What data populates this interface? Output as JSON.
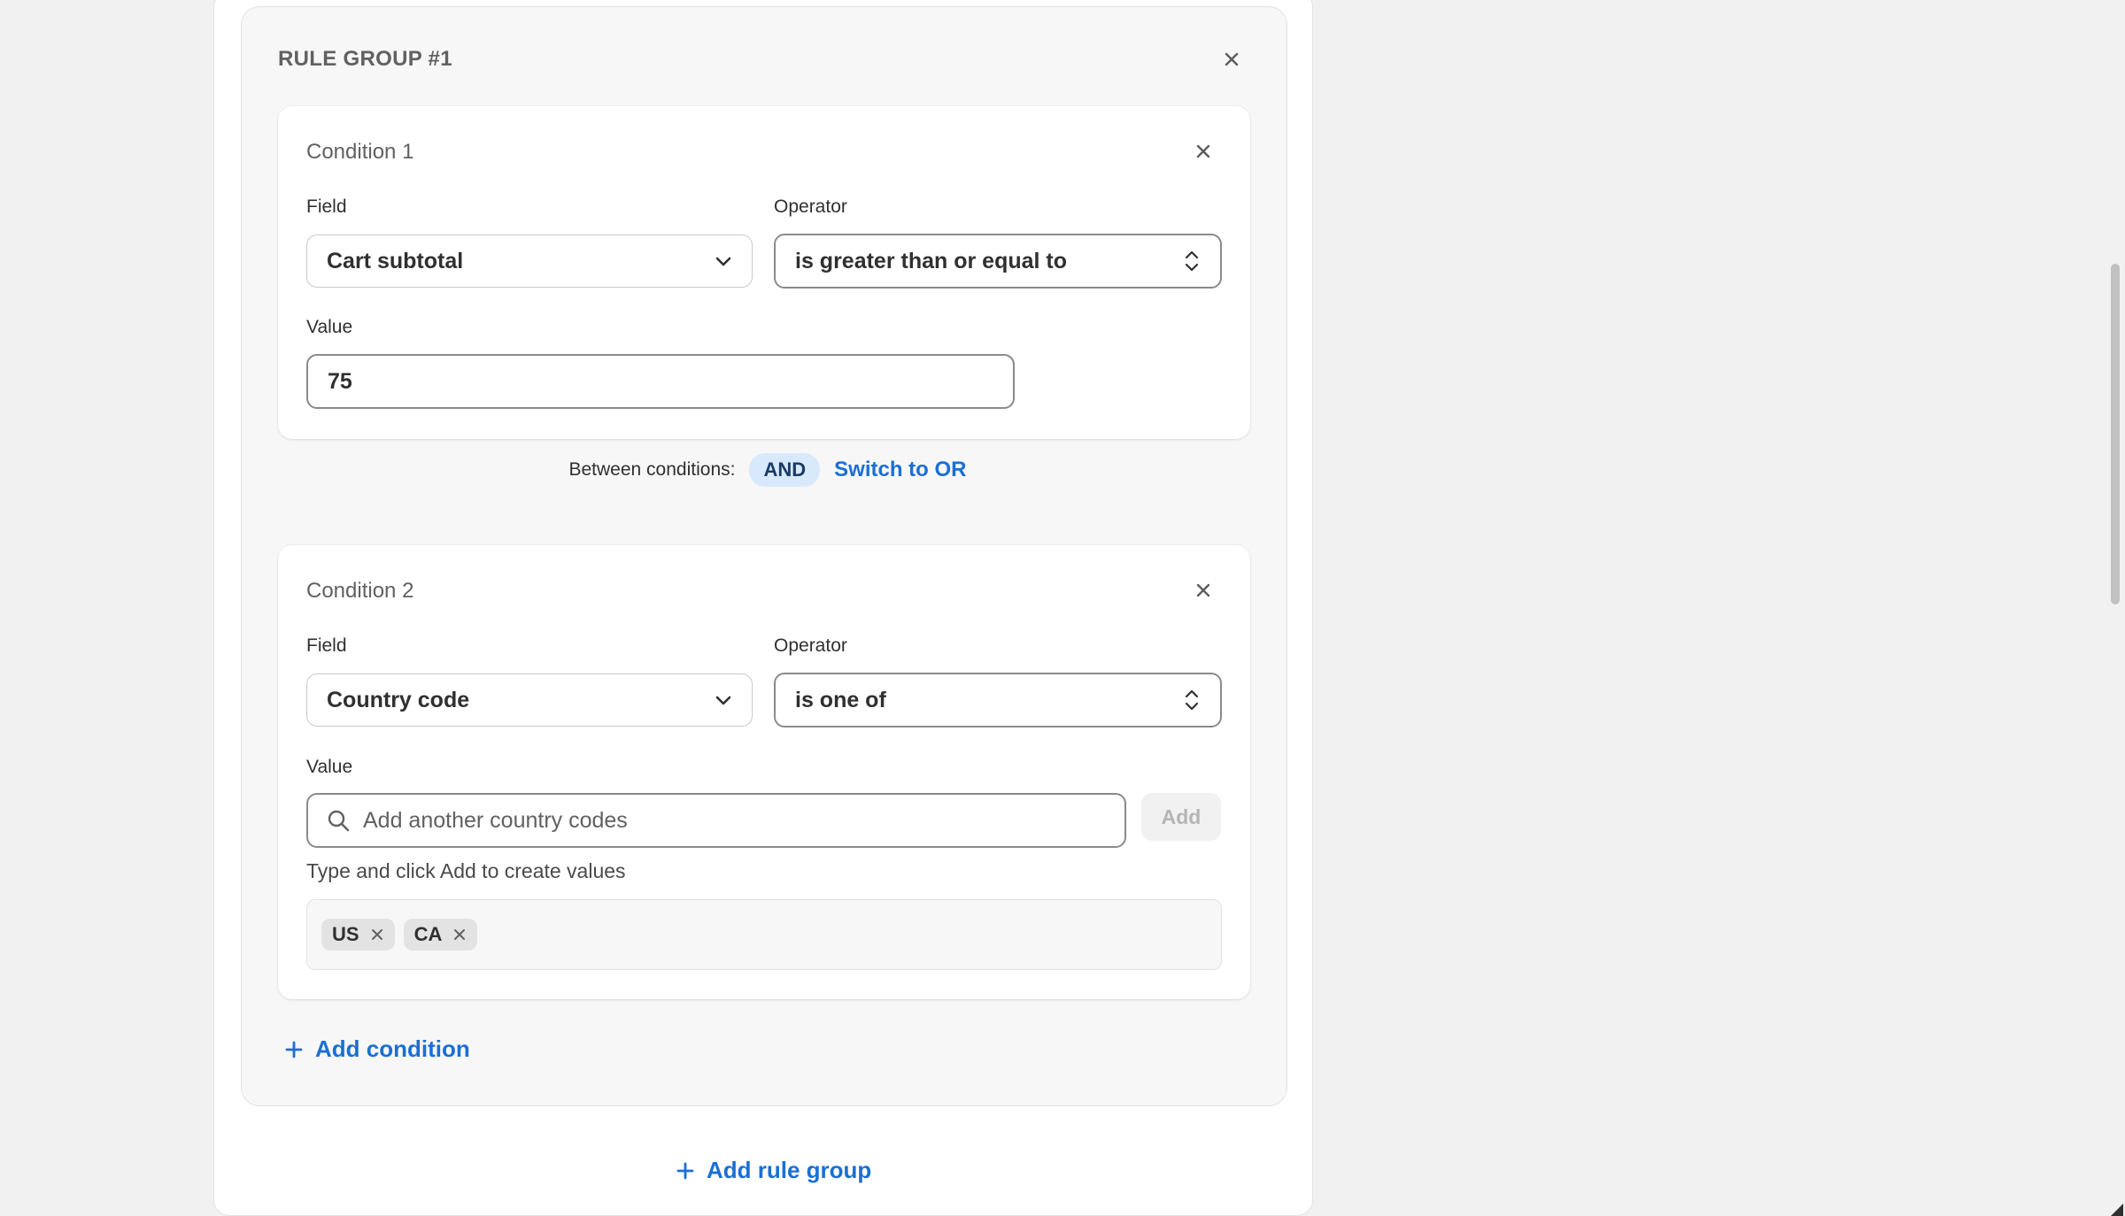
{
  "rule_group": {
    "title": "RULE GROUP #1",
    "close_icon": "close-icon"
  },
  "condition1": {
    "title": "Condition 1",
    "field_label": "Field",
    "field_value": "Cart subtotal",
    "operator_label": "Operator",
    "operator_value": "is greater than or equal to",
    "value_label": "Value",
    "value": "75"
  },
  "between": {
    "label": "Between conditions:",
    "mode": "AND",
    "switch_link": "Switch to OR"
  },
  "condition2": {
    "title": "Condition 2",
    "field_label": "Field",
    "field_value": "Country code",
    "operator_label": "Operator",
    "operator_value": "is one of",
    "value_label": "Value",
    "search_placeholder": "Add another country codes",
    "add_button": "Add",
    "helper_text": "Type and click Add to create values",
    "tags": [
      "US",
      "CA"
    ]
  },
  "actions": {
    "add_condition": "Add condition",
    "add_rule_group": "Add rule group"
  },
  "colors": {
    "accent_link": "#1a6fd4",
    "and_pill_bg": "#d8e9fb",
    "page_bg": "#f1f1f1"
  }
}
